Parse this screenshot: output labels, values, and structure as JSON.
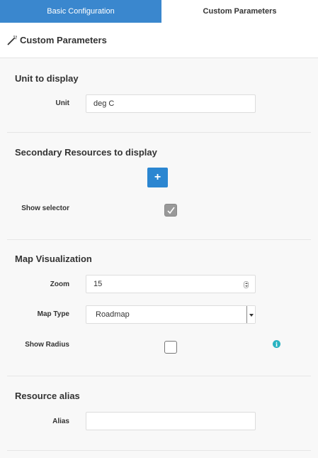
{
  "tabs": [
    {
      "label": "Basic Configuration",
      "active": true
    },
    {
      "label": "Custom Parameters",
      "active": false
    }
  ],
  "panel": {
    "title": "Custom Parameters",
    "icon": "magic-wand-icon"
  },
  "unit_section": {
    "title": "Unit to display",
    "unit_label": "Unit",
    "unit_value": "deg C"
  },
  "secondary_section": {
    "title": "Secondary Resources to display",
    "add_label": "+",
    "show_selector_label": "Show selector",
    "show_selector_checked": true
  },
  "map_section": {
    "title": "Map Visualization",
    "zoom_label": "Zoom",
    "zoom_value": "15",
    "map_type_label": "Map Type",
    "map_type_value": "Roadmap",
    "show_radius_label": "Show Radius",
    "show_radius_checked": false,
    "info_icon_text": "i"
  },
  "alias_section": {
    "title": "Resource alias",
    "alias_label": "Alias",
    "alias_value": ""
  },
  "colors": {
    "active_tab": "#3a87ce",
    "add_button": "#2b86d1",
    "info_icon": "#29b3c1"
  }
}
